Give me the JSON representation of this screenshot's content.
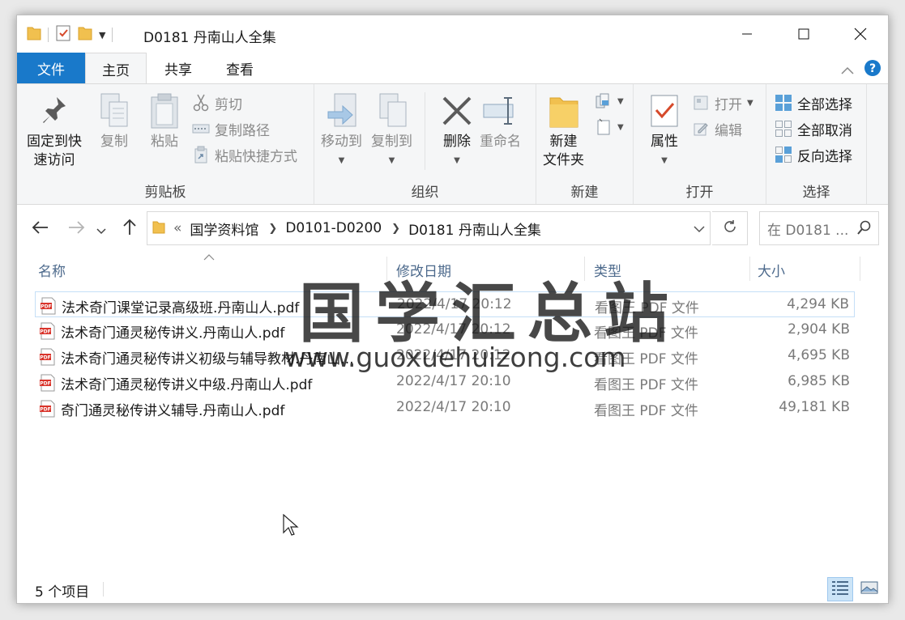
{
  "window": {
    "title": "D0181 丹南山人全集"
  },
  "ribbon_tabs": {
    "file": "文件",
    "home": "主页",
    "share": "共享",
    "view": "查看"
  },
  "clipboard": {
    "group_label": "剪贴板",
    "pin_label_1": "固定到快",
    "pin_label_2": "速访问",
    "copy": "复制",
    "paste": "粘贴",
    "cut": "剪切",
    "copy_path": "复制路径",
    "paste_shortcut": "粘贴快捷方式"
  },
  "organize": {
    "group_label": "组织",
    "move_to": "移动到",
    "copy_to": "复制到",
    "delete": "删除",
    "rename": "重命名"
  },
  "new": {
    "group_label": "新建",
    "new_folder_1": "新建",
    "new_folder_2": "文件夹"
  },
  "open": {
    "group_label": "打开",
    "properties": "属性",
    "open": "打开",
    "edit": "编辑"
  },
  "select": {
    "group_label": "选择",
    "select_all": "全部选择",
    "select_none": "全部取消",
    "invert": "反向选择"
  },
  "address": {
    "overflow": "«",
    "crumbs": [
      "国学资料馆",
      "D0101-D0200",
      "D0181 丹南山人全集"
    ]
  },
  "search": {
    "placeholder": "在 D0181 ..."
  },
  "columns": {
    "name": "名称",
    "date": "修改日期",
    "type": "类型",
    "size": "大小"
  },
  "files": [
    {
      "name": "法术奇门课堂记录高级班.丹南山人.pdf",
      "date": "2022/4/17 20:12",
      "type": "看图王 PDF 文件",
      "size": "4,294 KB"
    },
    {
      "name": "法术奇门通灵秘传讲义.丹南山人.pdf",
      "date": "2022/4/17 20:12",
      "type": "看图王 PDF 文件",
      "size": "2,904 KB"
    },
    {
      "name": "法术奇门通灵秘传讲义初级与辅导教材.丹南山...",
      "date": "2022/4/17 20:12",
      "type": "看图王 PDF 文件",
      "size": "4,695 KB"
    },
    {
      "name": "法术奇门通灵秘传讲义中级.丹南山人.pdf",
      "date": "2022/4/17 20:10",
      "type": "看图王 PDF 文件",
      "size": "6,985 KB"
    },
    {
      "name": "奇门通灵秘传讲义辅导.丹南山人.pdf",
      "date": "2022/4/17 20:10",
      "type": "看图王 PDF 文件",
      "size": "49,181 KB"
    }
  ],
  "watermark": {
    "title": "国学汇总站",
    "url": "www.guoxuehuizong.com"
  },
  "status": {
    "item_count": "5 个项目"
  },
  "colors": {
    "file_tab": "#1979ca",
    "accent": "#0078d7",
    "folder": "#f1c04f",
    "selection_border": "#c5dff7"
  },
  "icons": [
    "folder-icon",
    "checklist-icon",
    "pin-icon",
    "copy-icon",
    "paste-icon",
    "scissors-icon",
    "path-icon",
    "shortcut-icon",
    "move-icon",
    "delete-icon",
    "rename-icon",
    "new-item-icon",
    "properties-icon",
    "open-icon",
    "edit-icon",
    "select-all-icon",
    "select-none-icon",
    "invert-select-icon",
    "back-icon",
    "forward-icon",
    "up-icon",
    "refresh-icon",
    "search-icon",
    "pdf-file-icon",
    "help-icon"
  ]
}
